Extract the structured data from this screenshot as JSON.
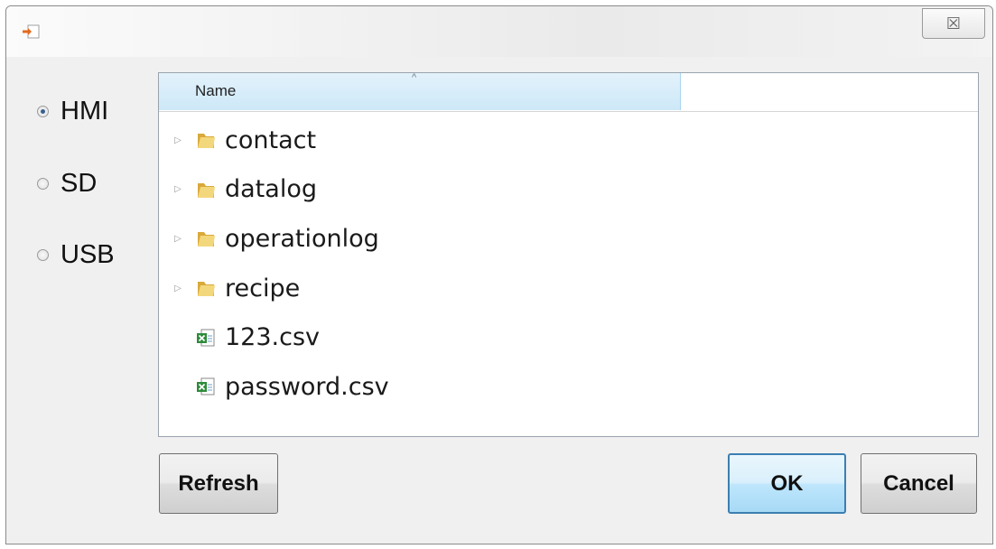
{
  "window": {
    "title": "",
    "close_glyph": "☒"
  },
  "storage": {
    "options": [
      {
        "label": "HMI",
        "checked": true
      },
      {
        "label": "SD",
        "checked": false
      },
      {
        "label": "USB",
        "checked": false
      }
    ]
  },
  "file_list": {
    "column_name": "Name",
    "column_extra": "",
    "sort_glyph": "^",
    "items": [
      {
        "name": "contact",
        "type": "folder"
      },
      {
        "name": "datalog",
        "type": "folder"
      },
      {
        "name": "operationlog",
        "type": "folder"
      },
      {
        "name": "recipe",
        "type": "folder"
      },
      {
        "name": "123.csv",
        "type": "csv"
      },
      {
        "name": "password.csv",
        "type": "csv"
      }
    ]
  },
  "buttons": {
    "refresh": "Refresh",
    "ok": "OK",
    "cancel": "Cancel"
  },
  "icons": {
    "app": "import-icon",
    "folder": "folder-icon",
    "csv": "excel-csv-icon",
    "expander": "expand-triangle-icon",
    "close": "close-icon"
  },
  "colors": {
    "header_highlight": "#cde8f8",
    "default_button_border": "#3c7fb1",
    "folder": "#e8c35a"
  }
}
